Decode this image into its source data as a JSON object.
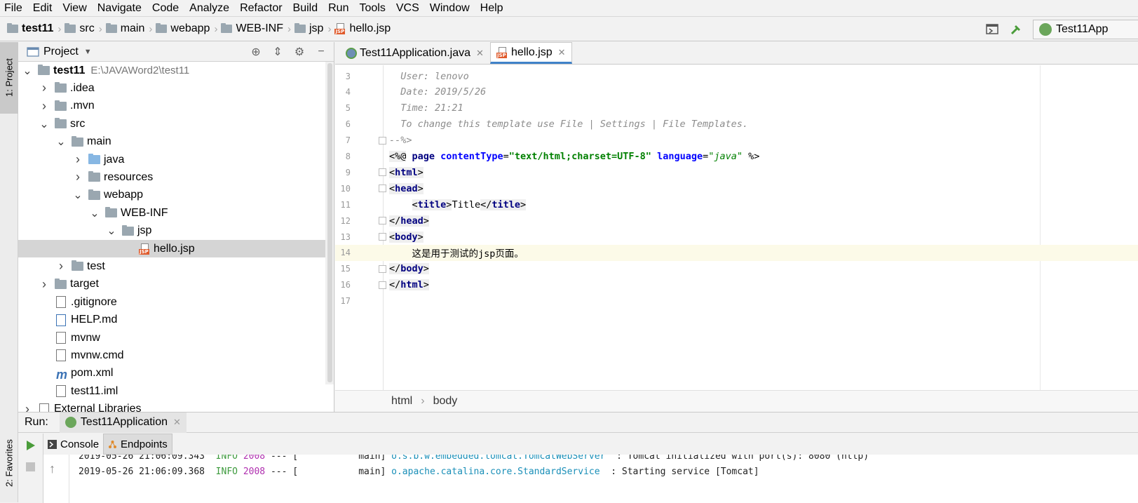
{
  "menu": [
    "File",
    "Edit",
    "View",
    "Navigate",
    "Code",
    "Analyze",
    "Refactor",
    "Build",
    "Run",
    "Tools",
    "VCS",
    "Window",
    "Help"
  ],
  "breadcrumbs": [
    "test11",
    "src",
    "main",
    "webapp",
    "WEB-INF",
    "jsp",
    "hello.jsp"
  ],
  "run_config": "Test11App",
  "left_tabs": {
    "project": "1: Project",
    "favorites": "2: Favorites"
  },
  "project_panel": {
    "title": "Project",
    "tree": [
      {
        "name": "test11",
        "path": "E:\\JAVAWord2\\test11",
        "depth": 0,
        "arrow": "v",
        "icon": "module",
        "bold": true
      },
      {
        "name": ".idea",
        "depth": 1,
        "arrow": ">",
        "icon": "folder"
      },
      {
        "name": ".mvn",
        "depth": 1,
        "arrow": ">",
        "icon": "folder"
      },
      {
        "name": "src",
        "depth": 1,
        "arrow": "v",
        "icon": "folder"
      },
      {
        "name": "main",
        "depth": 2,
        "arrow": "v",
        "icon": "folder"
      },
      {
        "name": "java",
        "depth": 3,
        "arrow": ">",
        "icon": "folder-blue"
      },
      {
        "name": "resources",
        "depth": 3,
        "arrow": ">",
        "icon": "folder"
      },
      {
        "name": "webapp",
        "depth": 3,
        "arrow": "v",
        "icon": "folder"
      },
      {
        "name": "WEB-INF",
        "depth": 4,
        "arrow": "v",
        "icon": "folder"
      },
      {
        "name": "jsp",
        "depth": 5,
        "arrow": "v",
        "icon": "folder"
      },
      {
        "name": "hello.jsp",
        "depth": 6,
        "arrow": "",
        "icon": "jsp",
        "selected": true
      },
      {
        "name": "test",
        "depth": 2,
        "arrow": ">",
        "icon": "folder"
      },
      {
        "name": "target",
        "depth": 1,
        "arrow": ">",
        "icon": "folder"
      },
      {
        "name": ".gitignore",
        "depth": 1,
        "arrow": "",
        "icon": "file"
      },
      {
        "name": "HELP.md",
        "depth": 1,
        "arrow": "",
        "icon": "md"
      },
      {
        "name": "mvnw",
        "depth": 1,
        "arrow": "",
        "icon": "file"
      },
      {
        "name": "mvnw.cmd",
        "depth": 1,
        "arrow": "",
        "icon": "file"
      },
      {
        "name": "pom.xml",
        "depth": 1,
        "arrow": "",
        "icon": "maven"
      },
      {
        "name": "test11.iml",
        "depth": 1,
        "arrow": "",
        "icon": "file"
      },
      {
        "name": "External Libraries",
        "depth": 0,
        "arrow": ">",
        "icon": "lib"
      }
    ]
  },
  "editor": {
    "tabs": [
      {
        "label": "Test11Application.java",
        "active": false
      },
      {
        "label": "hello.jsp",
        "active": true
      }
    ],
    "current_line": 14,
    "lines": [
      {
        "n": "3",
        "text": "  User: lenovo"
      },
      {
        "n": "4",
        "text": "  Date: 2019/5/26"
      },
      {
        "n": "5",
        "text": "  Time: 21:21"
      },
      {
        "n": "6",
        "text": "  To change this template use File | Settings | File Templates."
      },
      {
        "n": "7",
        "text": "--%>"
      },
      {
        "n": "8",
        "text": "<%@ page contentType=\"text/html;charset=UTF-8\" language=\"java\" %>"
      },
      {
        "n": "9",
        "text": "<html>"
      },
      {
        "n": "10",
        "text": "<head>"
      },
      {
        "n": "11",
        "text": "    <title>Title</title>"
      },
      {
        "n": "12",
        "text": "</head>"
      },
      {
        "n": "13",
        "text": "<body>"
      },
      {
        "n": "14",
        "text": "    这是用于测试的jsp页面。"
      },
      {
        "n": "15",
        "text": "</body>"
      },
      {
        "n": "16",
        "text": "</html>"
      },
      {
        "n": "17",
        "text": ""
      }
    ],
    "breadcrumb": [
      "html",
      "body"
    ]
  },
  "run_panel": {
    "label": "Run:",
    "config": "Test11Application",
    "tabs": [
      "Console",
      "Endpoints"
    ],
    "log": [
      {
        "ts": "2019-05-26 21:06:09.343",
        "level": "INFO",
        "pid": "2008",
        "sep": "--- [",
        "thread": "main]",
        "logger": "o.s.b.w.embedded.tomcat.TomcatWebServer",
        "msg": ": Tomcat initialized with port(s): 8080 (http)"
      },
      {
        "ts": "2019-05-26 21:06:09.368",
        "level": "INFO",
        "pid": "2008",
        "sep": "--- [",
        "thread": "main]",
        "logger": "o.apache.catalina.core.StandardService",
        "msg": ": Starting service [Tomcat]"
      }
    ]
  }
}
